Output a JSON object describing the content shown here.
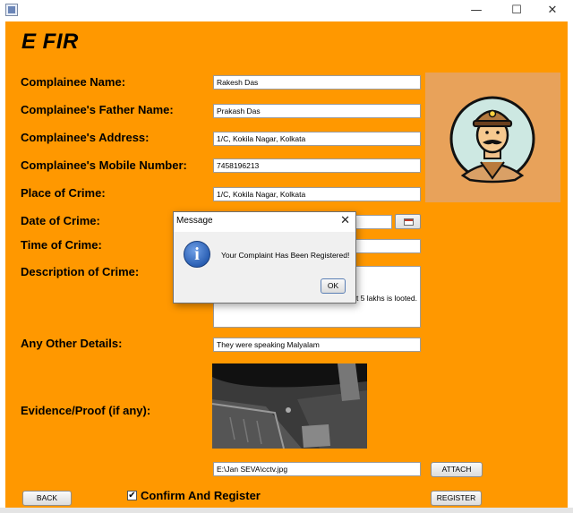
{
  "window": {
    "app_title": "E FIR",
    "min_glyph": "—",
    "max_glyph": "☐",
    "close_glyph": "✕"
  },
  "form": {
    "complainee_name_label": "Complainee Name:",
    "complainee_name_value": "Rakesh Das",
    "father_name_label": "Complainee's Father Name:",
    "father_name_value": "Prakash Das",
    "address_label": "Complainee's Address:",
    "address_value": "1/C, Kokila Nagar, Kolkata",
    "mobile_label": "Complainee's Mobile Number:",
    "mobile_value": "7458196213",
    "place_label": "Place of Crime:",
    "place_value": "1/C, Kokila Nagar, Kolkata",
    "date_label": "Date of Crime:",
    "date_value": "",
    "time_label": "Time of Crime:",
    "time_value": "",
    "description_label": "Description of Crime:",
    "description_visible_text": "t 5 lakhs is looted.",
    "other_details_label": "Any Other Details:",
    "other_details_value": "They were speaking Malyalam",
    "evidence_label": "Evidence/Proof (if any):",
    "evidence_path_value": "E:\\Jan SEVA\\cctv.jpg",
    "attach_button": "ATTACH",
    "back_button": "BACK",
    "confirm_label": "Confirm And Register",
    "confirm_checked": true,
    "check_glyph": "✔",
    "register_button": "REGISTER"
  },
  "dialog": {
    "title": "Message",
    "close_glyph": "✕",
    "icon": "i",
    "message": "Your Complaint Has Been Registered!",
    "ok_button": "OK"
  },
  "colors": {
    "form_background": "#ff9800",
    "avatar_panel": "#e8a25a",
    "dialog_background": "#f0f0f0",
    "info_icon": "#2a5fb3"
  }
}
